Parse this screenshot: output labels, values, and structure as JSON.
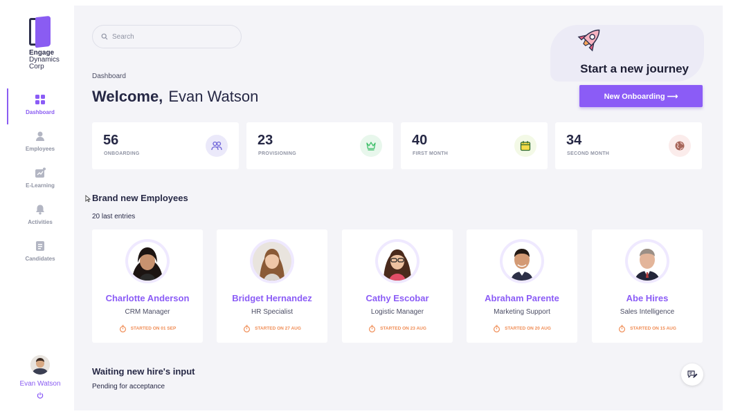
{
  "brand": {
    "name_line1": "Engage",
    "name_line2": "Dynamics",
    "name_line3": "Corp",
    "accent": "#8b5cf6"
  },
  "nav": [
    {
      "label": "Dashboard",
      "icon": "grid-icon",
      "active": true
    },
    {
      "label": "Employees",
      "icon": "person-icon",
      "active": false
    },
    {
      "label": "E-Learning",
      "icon": "chart-icon",
      "active": false
    },
    {
      "label": "Activities",
      "icon": "bell-icon",
      "active": false
    },
    {
      "label": "Candidates",
      "icon": "document-icon",
      "active": false
    }
  ],
  "user": {
    "name": "Evan Watson"
  },
  "search": {
    "placeholder": "Search",
    "value": ""
  },
  "breadcrumb": "Dashboard",
  "welcome": {
    "word": "Welcome,",
    "name": "Evan Watson"
  },
  "hero": {
    "title": "Start a new journey",
    "button": "New Onboarding ⟶"
  },
  "stats": [
    {
      "value": "56",
      "label": "ONBOARDING",
      "icon": "people-icon",
      "color": "#6d62d9"
    },
    {
      "value": "23",
      "label": "PROVISIONING",
      "icon": "crown-icon",
      "color": "#3fbf6a"
    },
    {
      "value": "40",
      "label": "FIRST MONTH",
      "icon": "calendar-icon",
      "color": "#3f9a3f"
    },
    {
      "value": "34",
      "label": "SECOND MONTH",
      "icon": "globe-icon",
      "color": "#d9534f"
    }
  ],
  "employees_section": {
    "title": "Brand new Employees",
    "subtitle": "20 last entries"
  },
  "employees": [
    {
      "name": "Charlotte Anderson",
      "role": "CRM Manager",
      "started": "STARTED ON 01 SEP"
    },
    {
      "name": "Bridget Hernandez",
      "role": "HR Specialist",
      "started": "STARTED ON 27 AUG"
    },
    {
      "name": "Cathy Escobar",
      "role": "Logistic Manager",
      "started": "STARTED ON 23 AUG"
    },
    {
      "name": "Abraham Parente",
      "role": "Marketing Support",
      "started": "STARTED ON 20 AUG"
    },
    {
      "name": "Abe Hires",
      "role": "Sales Intelligence",
      "started": "STARTED ON 15 AUG"
    }
  ],
  "waiting_section": {
    "title": "Waiting new hire's input",
    "subtitle": "Pending for acceptance"
  }
}
